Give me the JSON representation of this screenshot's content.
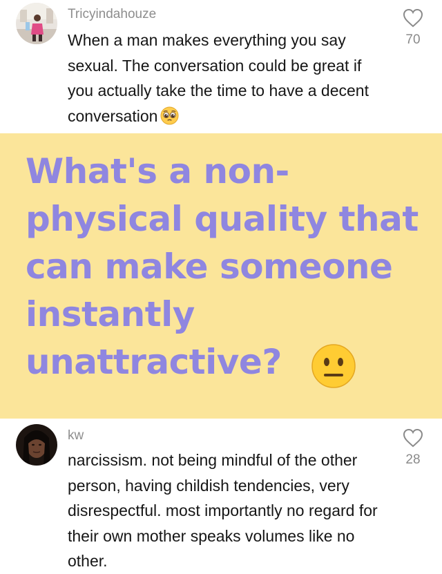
{
  "comments": [
    {
      "username": "Tricyindahouze",
      "text": "When a man makes everything you say sexual. The conversation could be great if you actually take the time to have a decent conversation",
      "emoji": "pleading-face-icon",
      "likes": "70"
    },
    {
      "username": "kw",
      "text": "narcissism. not being mindful of the other person, having childish tendencies, very disrespectful. most importantly no regard for their own mother speaks volumes like no other.",
      "likes": "28"
    }
  ],
  "banner": {
    "question": "What's a non-physical quality that can make someone instantly unattractive?",
    "emoji": "neutral-face-icon",
    "background": "#fbe59a",
    "text_color": "#8f86e0"
  },
  "colors": {
    "username": "#8d8d8d",
    "body_text": "#161616",
    "like_count": "#8a8a8a"
  }
}
